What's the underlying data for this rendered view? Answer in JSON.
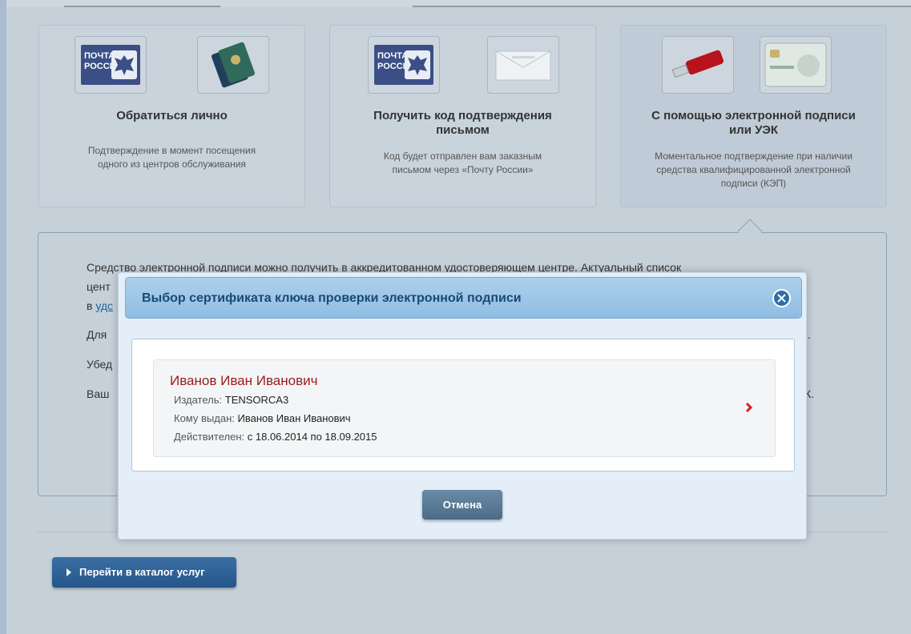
{
  "options": [
    {
      "title_lines": [
        "Обратиться лично"
      ],
      "desc_lines": [
        "Подтверждение в момент посещения",
        "одного из центров обслуживания"
      ]
    },
    {
      "title_lines": [
        "Получить код подтверждения",
        "письмом"
      ],
      "desc_lines": [
        "Код будет отправлен вам заказным",
        "письмом через «Почту России»"
      ]
    },
    {
      "title_lines": [
        "С помощью электронной подписи",
        "или УЭК"
      ],
      "desc_lines": [
        "Моментальное подтверждение при наличии",
        "средства квалифицированной электронной",
        "подписи (КЭП)"
      ]
    }
  ],
  "logo": {
    "line1": "ПОЧТА",
    "line2": "РОССИИ"
  },
  "background_text": {
    "line1": "Средство электронной подписи можно получить в аккредитованном удостоверяющем центре. Актуальный список",
    "line2": "цент",
    "line3_prefix": "в ",
    "line3_link": "удс",
    "line4": "Для",
    "line4_end": ".",
    "line5": "Убед",
    "line6": "Ваш",
    "line6_end": "К."
  },
  "modal": {
    "title": "Выбор сертификата ключа проверки электронной подписи",
    "certificate": {
      "name": "Иванов Иван Иванович",
      "issuer_label": "Издатель:",
      "issuer": "TENSORCA3",
      "issued_to_label": "Кому выдан:",
      "issued_to": "Иванов Иван Иванович",
      "valid_label": "Действителен:",
      "valid": "с 18.06.2014 по 18.09.2015"
    },
    "cancel_label": "Отмена"
  },
  "catalog_button_label": "Перейти в каталог услуг",
  "colors": {
    "accent": "#2d6fa8",
    "certificate_name": "#9b1b1b",
    "arrow": "#d0202a"
  },
  "icons": [
    "pochta-rossii-logo",
    "passport-icon",
    "envelope-icon",
    "usb-token-icon",
    "uek-card-icon",
    "close-icon",
    "chevron-right-icon",
    "play-triangle-icon"
  ]
}
